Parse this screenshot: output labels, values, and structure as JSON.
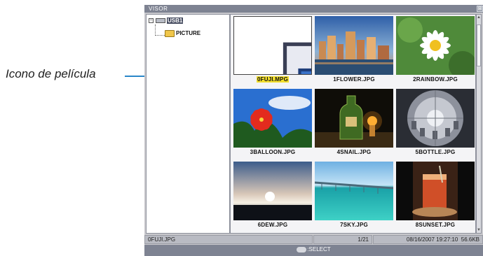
{
  "callout": {
    "label": "Icono de película"
  },
  "window": {
    "title": "VISOR",
    "close_glyph": "⊠"
  },
  "tree": {
    "root": {
      "label": "USB1",
      "icon": "drive-icon",
      "expander": "−"
    },
    "child": {
      "label": "PICTURE",
      "icon": "folder-icon"
    }
  },
  "thumbnails": [
    {
      "name": "0FUJI.MPG",
      "kind": "movie",
      "selected": true
    },
    {
      "name": "1FLOWER.JPG",
      "kind": "city"
    },
    {
      "name": "2RAINBOW.JPG",
      "kind": "daisy"
    },
    {
      "name": "3BALLOON.JPG",
      "kind": "hibiscus"
    },
    {
      "name": "4SNAIL.JPG",
      "kind": "bottle"
    },
    {
      "name": "5BOTTLE.JPG",
      "kind": "dome"
    },
    {
      "name": "6DEW.JPG",
      "kind": "sunset"
    },
    {
      "name": "7SKY.JPG",
      "kind": "bridge"
    },
    {
      "name": "8SUNSET.JPG",
      "kind": "drink"
    }
  ],
  "status": {
    "filename": "0FUJI.JPG",
    "index": "1/21",
    "datetime": "08/16/2007 19:27:10",
    "size": "56.6KB"
  },
  "footer": {
    "hint": ":SELECT",
    "key_icon": "exit-key-icon"
  },
  "colors": {
    "accent_title": "#7e8392",
    "selection_highlight": "#f3df2c",
    "callout_line": "#2a86c8"
  }
}
